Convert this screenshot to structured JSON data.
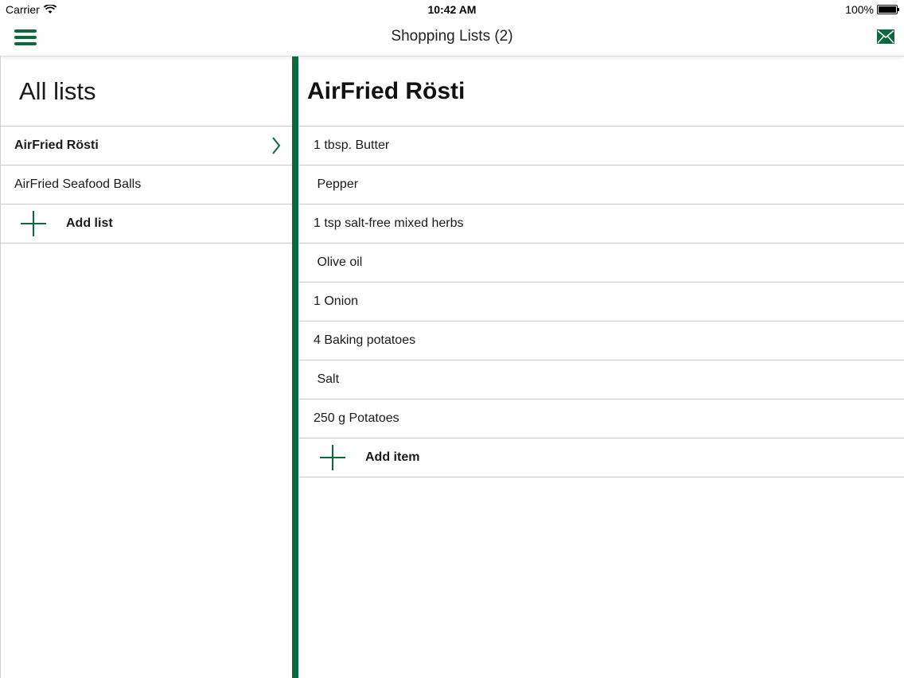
{
  "status_bar": {
    "carrier": "Carrier",
    "time": "10:42 AM",
    "battery": "100%",
    "battery_level": 1.0
  },
  "nav": {
    "title": "Shopping Lists (2)",
    "menu_icon": "hamburger-menu-icon",
    "mail_icon": "mail-icon"
  },
  "sidebar": {
    "title": "All lists",
    "lists": [
      {
        "label": "AirFried Rösti",
        "selected": true
      },
      {
        "label": "AirFried Seafood Balls",
        "selected": false
      }
    ],
    "add_label": "Add list"
  },
  "detail": {
    "title": "AirFried Rösti",
    "items": [
      "1 tbsp. Butter",
      " Pepper",
      "1 tsp salt-free mixed herbs",
      " Olive oil",
      "1 Onion",
      "4 Baking potatoes",
      " Salt",
      "250 g Potatoes"
    ],
    "add_label": "Add item"
  },
  "colors": {
    "accent": "#0a6a3d",
    "divider": "#c8c8c8"
  }
}
